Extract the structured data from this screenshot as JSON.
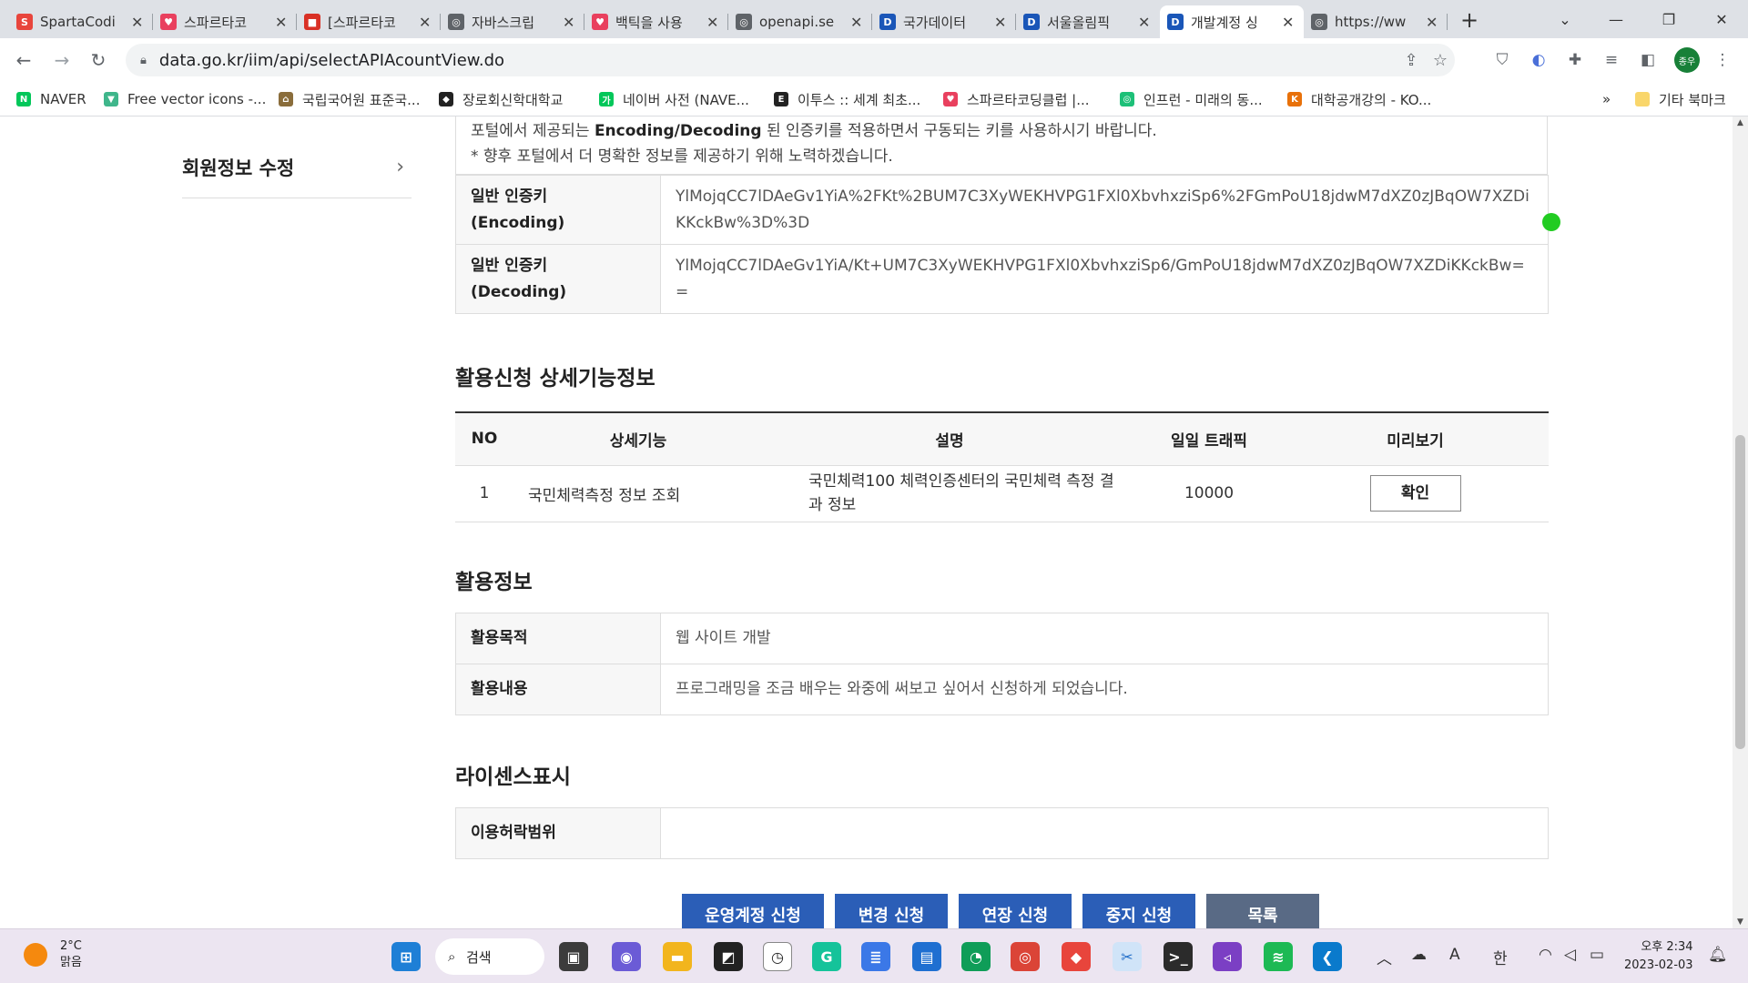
{
  "browser": {
    "tabs": [
      {
        "title": "SpartaCodi",
        "color": "#e8453c",
        "glyph": "S"
      },
      {
        "title": "스파르타코",
        "color": "#e9405e",
        "glyph": "♥"
      },
      {
        "title": "[스파르타코",
        "color": "#d93025",
        "glyph": "■"
      },
      {
        "title": "자바스크립",
        "color": "#5f6368",
        "glyph": "◎"
      },
      {
        "title": "백틱을 사용",
        "color": "#e9405e",
        "glyph": "♥"
      },
      {
        "title": "openapi.se",
        "color": "#5f6368",
        "glyph": "◎"
      },
      {
        "title": "국가데이터",
        "color": "#1a56b8",
        "glyph": "D"
      },
      {
        "title": "서울올림픽",
        "color": "#1a56b8",
        "glyph": "D"
      },
      {
        "title": "개발계정 싱",
        "color": "#1a56b8",
        "glyph": "D"
      },
      {
        "title": "https://ww",
        "color": "#5f6368",
        "glyph": "◎"
      }
    ],
    "active_tab_index": 8,
    "url": "data.go.kr/iim/api/selectAPIAcountView.do",
    "avatar_label": "종우",
    "bookmarks": [
      {
        "label": "NAVER",
        "color": "#03c75a",
        "glyph": "N"
      },
      {
        "label": "Free vector icons -...",
        "color": "#3fb68b",
        "glyph": "▼"
      },
      {
        "label": "국립국어원 표준국...",
        "color": "#8a6d3b",
        "glyph": "⌂"
      },
      {
        "label": "장로회신학대학교",
        "color": "#222222",
        "glyph": "◆"
      },
      {
        "label": "네이버 사전 (NAVE...",
        "color": "#03c75a",
        "glyph": "가"
      },
      {
        "label": "이투스 :: 세계 최초...",
        "color": "#222222",
        "glyph": "E"
      },
      {
        "label": "스파르타코딩클럽 |...",
        "color": "#e9405e",
        "glyph": "♥"
      },
      {
        "label": "인프런 - 미래의 동...",
        "color": "#1dc078",
        "glyph": "◎"
      },
      {
        "label": "대학공개강의 - KO...",
        "color": "#e8710a",
        "glyph": "K"
      }
    ],
    "bookmarks_more": "»",
    "other_bookmarks": "기타 북마크"
  },
  "page": {
    "sidebar_item": "회원정보 수정",
    "notice_line1_pre": "포털에서 제공되는 ",
    "notice_line1_bold": "Encoding/Decoding",
    "notice_line1_post": " 된 인증키를 적용하면서 구동되는 키를 사용하시기 바랍니다.",
    "notice_line2": "* 향후 포털에서 더 명확한 정보를 제공하기 위해 노력하겠습니다.",
    "keys": [
      {
        "label_line1": "일반 인증키",
        "label_line2": "(Encoding)",
        "value": "YlMojqCC7lDAeGv1YiA%2FKt%2BUM7C3XyWEKHVPG1FXl0XbvhxziSp6%2FGmPoU18jdwM7dXZ0zJBqOW7XZDiKKckBw%3D%3D"
      },
      {
        "label_line1": "일반 인증키",
        "label_line2": "(Decoding)",
        "value": "YlMojqCC7lDAeGv1YiA/Kt+UM7C3XyWEKHVPG1FXl0XbvhxziSp6/GmPoU18jdwM7dXZ0zJBqOW7XZDiKKckBw=="
      }
    ],
    "detail_title": "활용신청 상세기능정보",
    "detail_headers": {
      "no": "NO",
      "feature": "상세기능",
      "desc": "설명",
      "traffic": "일일 트래픽",
      "preview": "미리보기"
    },
    "detail_rows": [
      {
        "no": "1",
        "feature": "국민체력측정 정보 조회",
        "desc": "국민체력100 체력인증센터의 국민체력 측정 결과 정보",
        "traffic": "10000",
        "preview": "확인"
      }
    ],
    "usage_title": "활용정보",
    "usage_rows": [
      {
        "label": "활용목적",
        "value": "웹 사이트 개발"
      },
      {
        "label": "활용내용",
        "value": "프로그래밍을 조금 배우는 와중에 써보고 싶어서 신청하게 되었습니다."
      }
    ],
    "license_title": "라이센스표시",
    "license_rows": [
      {
        "label": "이용허락범위",
        "value": ""
      }
    ],
    "buttons": {
      "operate": "운영계정 신청",
      "change": "변경 신청",
      "extend": "연장 신청",
      "stop": "중지 신청",
      "list": "목록"
    }
  },
  "taskbar": {
    "temperature": "2°C",
    "weather": "맑음",
    "search": "검색",
    "ime_mode": "한",
    "ime_font": "A",
    "time": "오후 2:34",
    "date": "2023-02-03"
  }
}
